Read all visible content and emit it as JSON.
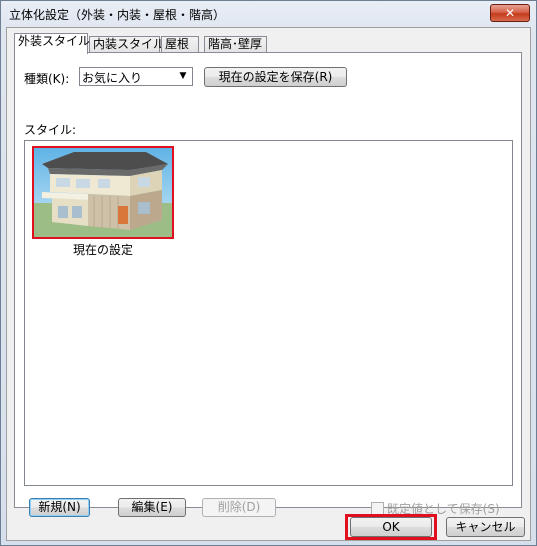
{
  "window": {
    "title": "立体化設定（外装・内装・屋根・階高）",
    "close_glyph": "✕"
  },
  "tabs": [
    {
      "label": "外装スタイル",
      "active": true
    },
    {
      "label": "内装スタイル",
      "active": false
    },
    {
      "label": "屋根",
      "active": false
    },
    {
      "label": "階高･壁厚",
      "active": false
    }
  ],
  "type_row": {
    "label": "種類(K):",
    "selected": "お気に入り",
    "save_current_label": "現在の設定を保存(R)"
  },
  "style_label": "スタイル:",
  "styles": [
    {
      "label": "現在の設定",
      "selected": true
    }
  ],
  "bottom_buttons": {
    "new_label": "新規(N)",
    "edit_label": "編集(E)",
    "delete_label": "削除(D)",
    "save_default_label": "既定値として保存(S)"
  },
  "footer": {
    "ok_label": "OK",
    "cancel_label": "キャンセル"
  },
  "colors": {
    "highlight": "#e0101e",
    "roof": "#545454",
    "wall": "#e9e3c8",
    "sky": "#9fd2ee",
    "grass": "#9cbd86"
  }
}
